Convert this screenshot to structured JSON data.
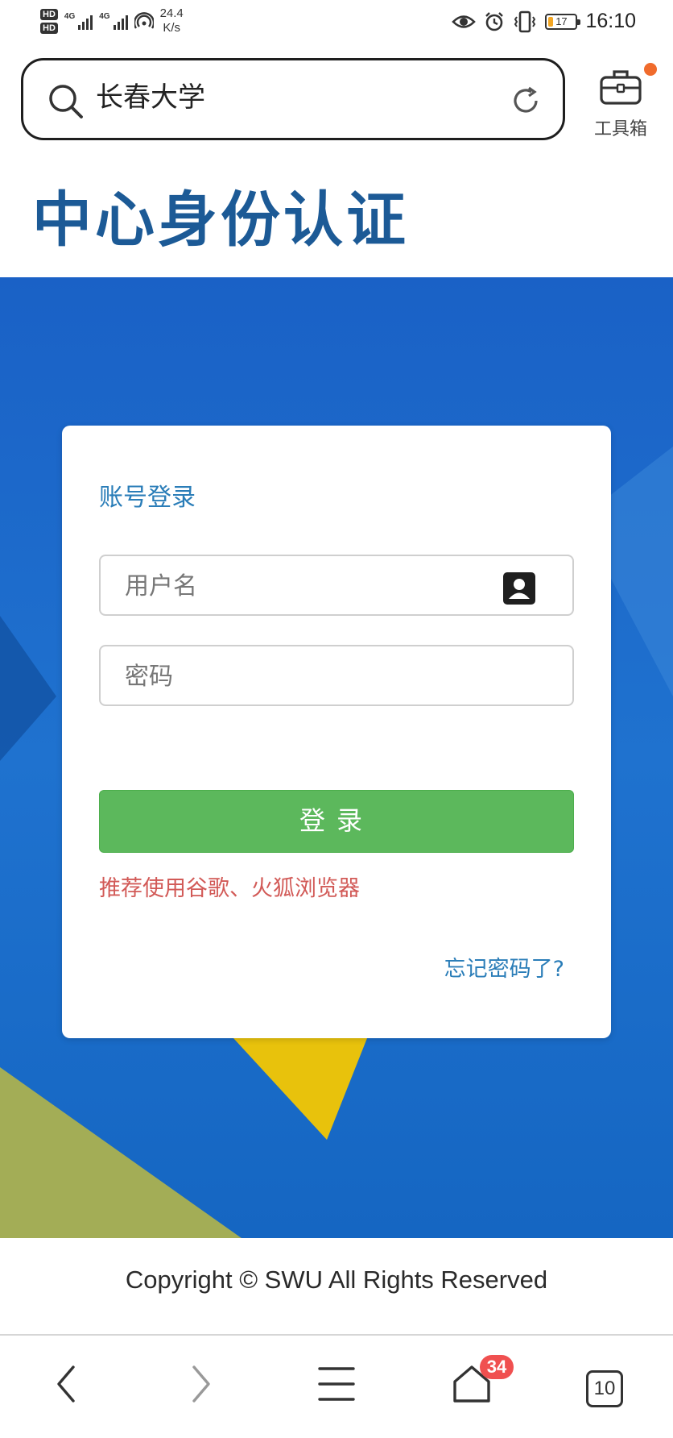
{
  "status_bar": {
    "hd1": "HD",
    "hd2": "HD",
    "network1": "4G",
    "network2": "4G",
    "speed_value": "24.4",
    "speed_unit": "K/s",
    "battery_level": "17",
    "time": "16:10",
    "icons": [
      "eye-icon",
      "alarm-icon",
      "vibrate-icon",
      "battery-icon"
    ]
  },
  "address_bar": {
    "query": "长春大学",
    "icons": [
      "search-icon",
      "reload-icon"
    ]
  },
  "toolbox": {
    "label": "工具箱",
    "dot_color": "#f06b2c"
  },
  "page": {
    "site_title": "中心身份认证",
    "title_color": "#1c5a96",
    "hero_color": "#1564c0"
  },
  "login": {
    "title": "账号登录",
    "username_placeholder": "用户名",
    "password_placeholder": "密码",
    "button_label": "登录",
    "browser_tip": "推荐使用谷歌、火狐浏览器",
    "forgot_link": "忘记密码了?",
    "button_color": "#5cb85c",
    "tip_color": "#d25a57"
  },
  "footer": {
    "copyright": "Copyright © SWU All Rights Reserved"
  },
  "bottom_nav": {
    "items": [
      "back-icon",
      "forward-icon",
      "menu-icon",
      "home-icon",
      "tabs-icon"
    ],
    "home_badge": "34",
    "tabs_count": "10"
  }
}
